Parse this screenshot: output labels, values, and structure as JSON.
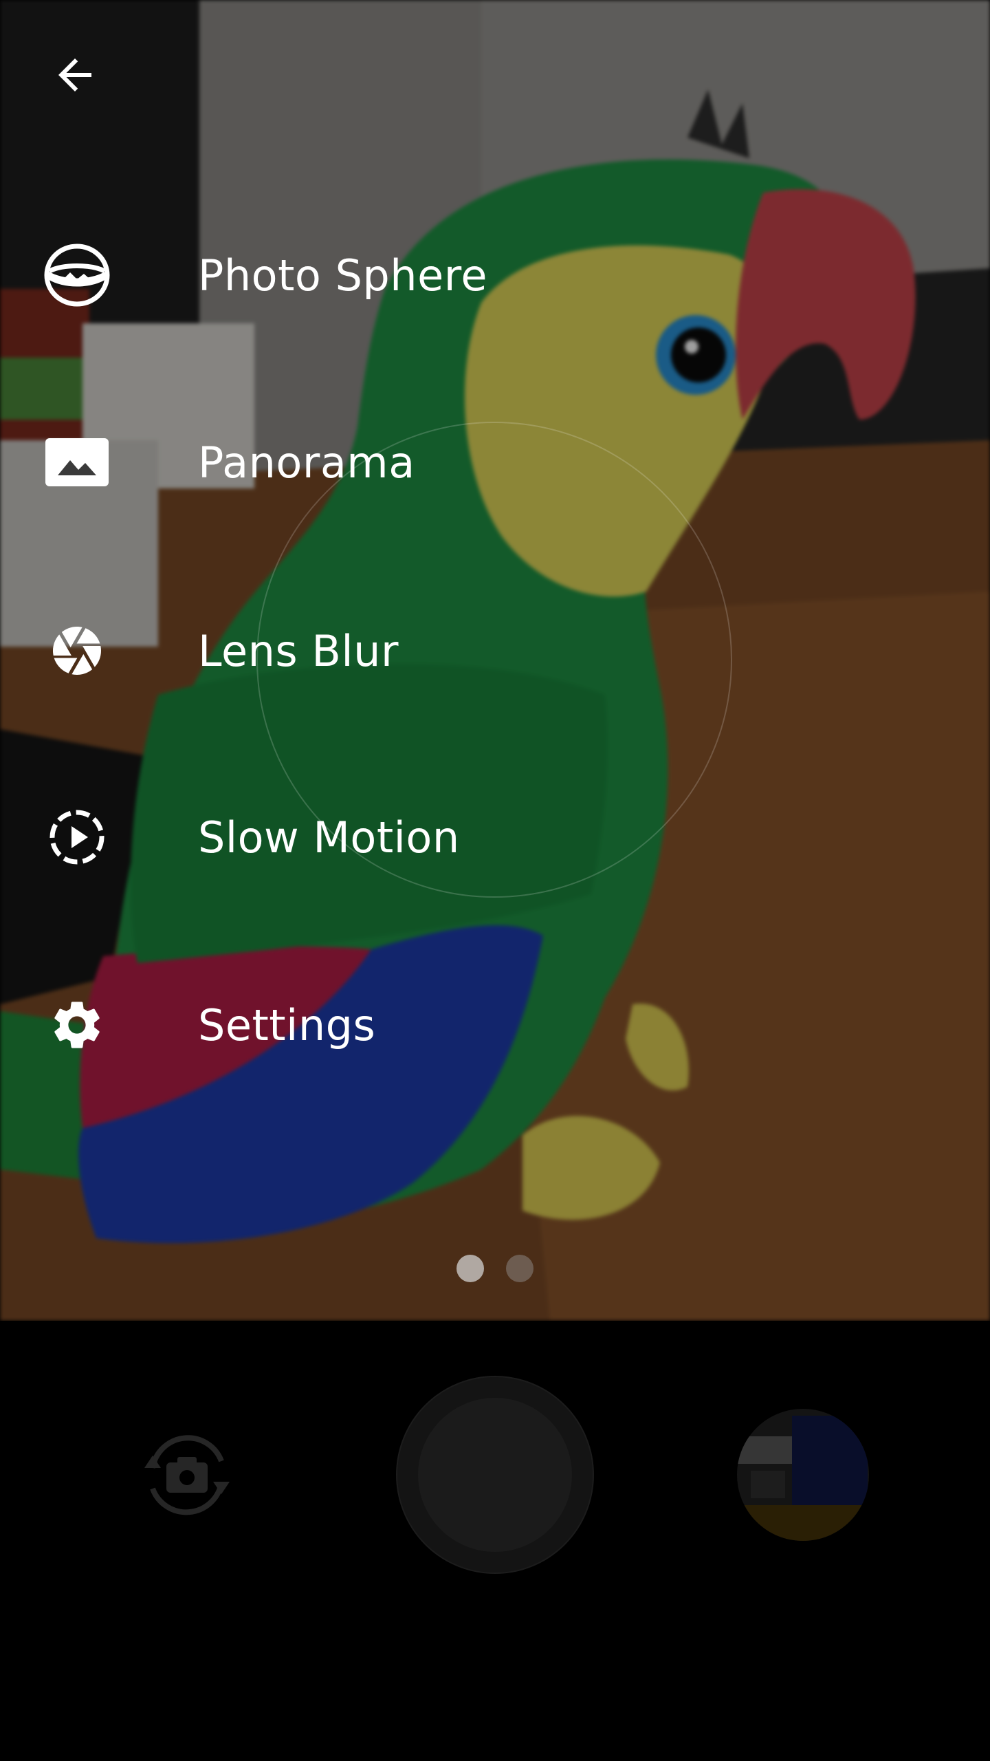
{
  "header": {
    "back_icon": "arrow-back-icon"
  },
  "menu": {
    "items": [
      {
        "label": "Photo Sphere",
        "icon": "photo-sphere-icon"
      },
      {
        "label": "Panorama",
        "icon": "panorama-icon"
      },
      {
        "label": "Lens Blur",
        "icon": "lens-blur-icon"
      },
      {
        "label": "Slow Motion",
        "icon": "slow-motion-icon"
      },
      {
        "label": "Settings",
        "icon": "gear-icon"
      }
    ]
  },
  "pager": {
    "pages": 2,
    "current": 1
  },
  "controls": {
    "switch_icon": "switch-camera-icon",
    "shutter": "shutter-button",
    "thumbnail": "last-photo-thumbnail"
  },
  "colors": {
    "menu_text": "#ffffff",
    "control_bar": "#000000"
  }
}
